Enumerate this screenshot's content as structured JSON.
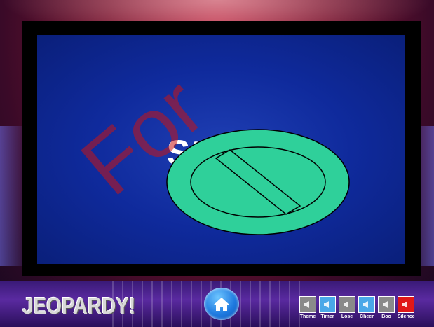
{
  "board": {
    "answer_text": "Stroke",
    "watermark_text": "For"
  },
  "branding": {
    "logo_text": "JEOPARDY!"
  },
  "controls": {
    "home_icon": "home-icon",
    "sounds": [
      {
        "label": "Theme",
        "color": "#8a8a8a",
        "icon": "speaker-icon"
      },
      {
        "label": "Timer",
        "color": "#4aa8e8",
        "icon": "speaker-icon"
      },
      {
        "label": "Lose",
        "color": "#8a8a8a",
        "icon": "speaker-icon"
      },
      {
        "label": "Cheer",
        "color": "#4aa8e8",
        "icon": "speaker-icon"
      },
      {
        "label": "Boo",
        "color": "#8a8a8a",
        "icon": "speaker-icon"
      },
      {
        "label": "Silence",
        "color": "#e01818",
        "icon": "speaker-icon"
      }
    ]
  },
  "colors": {
    "no_sign_fill": "#2fd09a",
    "board_blue": "#1f3fb4"
  }
}
